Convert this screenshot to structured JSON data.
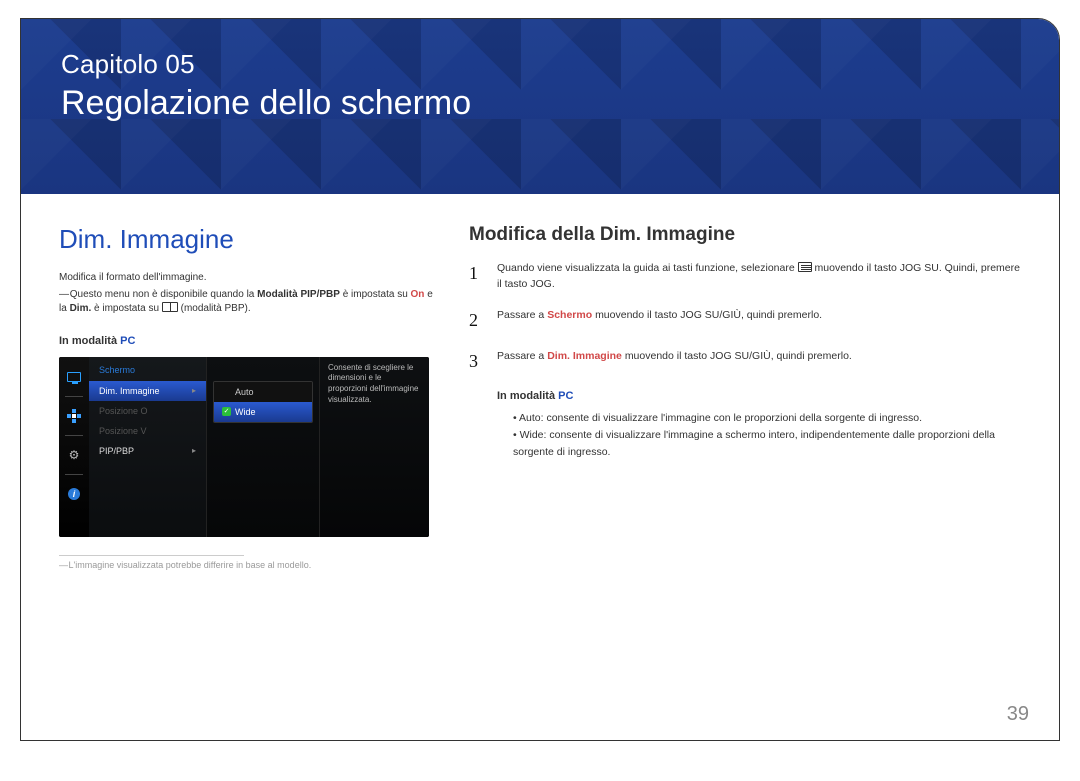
{
  "banner": {
    "chapter_label": "Capitolo 05",
    "chapter_title": "Regolazione dello schermo"
  },
  "left": {
    "section_heading": "Dim. Immagine",
    "intro": "Modifica il formato dell'immagine.",
    "note_prefix": "Questo menu non è disponibile quando la ",
    "note_bold1": "Modalità PIP/PBP",
    "note_mid": " è impostata su ",
    "note_on": "On",
    "note_and": " e la ",
    "note_bold2": "Dim.",
    "note_set": " è impostata su ",
    "note_pbp_suffix": " (modalità PBP).",
    "mode_prefix": "In modalità ",
    "mode_pc": "PC",
    "osd": {
      "menu_title": "Schermo",
      "items": {
        "dim": "Dim. Immagine",
        "poso": "Posizione O",
        "posv": "Posizione V",
        "pipbp": "PIP/PBP"
      },
      "options": {
        "auto": "Auto",
        "wide": "Wide"
      },
      "desc": "Consente di scegliere le dimensioni e le proporzioni dell'immagine visualizzata."
    },
    "footnote": "L'immagine visualizzata potrebbe differire in base al modello."
  },
  "right": {
    "heading": "Modifica della Dim. Immagine",
    "steps": {
      "s1a": "Quando viene visualizzata la guida ai tasti funzione, selezionare ",
      "s1b": " muovendo il tasto JOG SU. Quindi, premere il tasto JOG.",
      "s2a": "Passare a ",
      "s2_schermo": "Schermo",
      "s2b": " muovendo il tasto JOG SU/GIÙ, quindi premerlo.",
      "s3a": "Passare a ",
      "s3_dim": "Dim. Immagine",
      "s3b": " muovendo il tasto JOG SU/GIÙ, quindi premerlo."
    },
    "mode_prefix": "In modalità ",
    "mode_pc": "PC",
    "bullets": {
      "auto_label": "Auto",
      "auto_text": ": consente di visualizzare l'immagine con le proporzioni della sorgente di ingresso.",
      "wide_label": "Wide",
      "wide_text": ": consente di visualizzare l'immagine a schermo intero, indipendentemente dalle proporzioni della sorgente di ingresso."
    }
  },
  "page_number": "39"
}
